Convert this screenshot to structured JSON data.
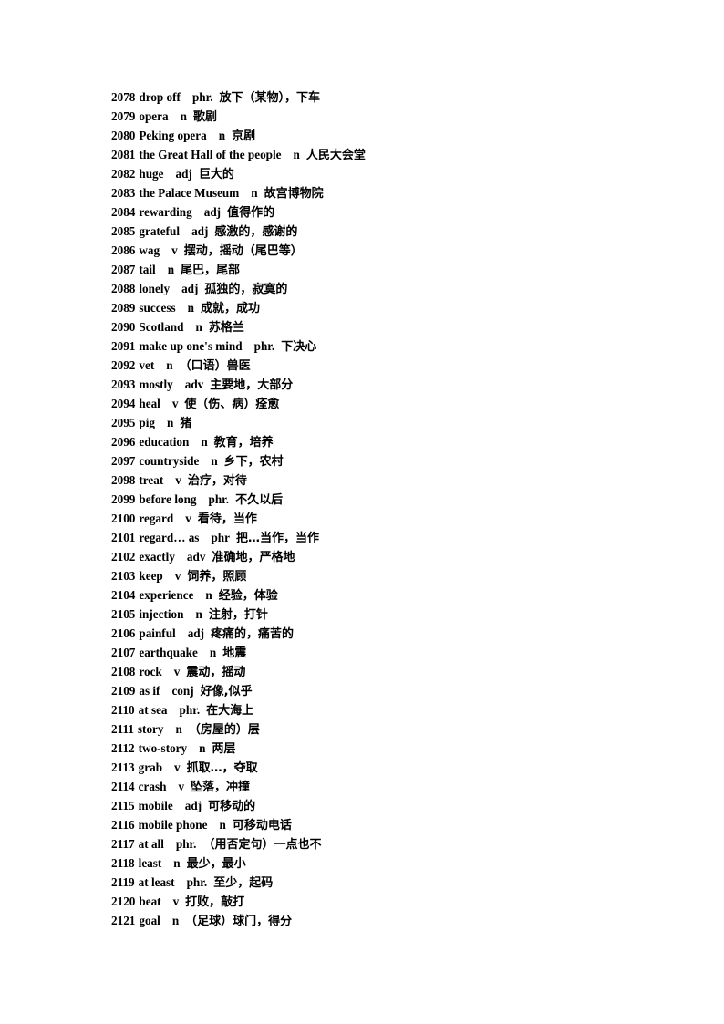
{
  "document": {
    "type": "vocabulary-word-list",
    "entry_range": "2078-2121",
    "entry_count": 44,
    "text_color": "#000000",
    "background_color": "#ffffff"
  },
  "entries": [
    {
      "index": "2078",
      "term": "drop off",
      "pos": "phr.",
      "definition": "放下（某物），下车"
    },
    {
      "index": "2079",
      "term": "opera",
      "pos": "n",
      "definition": "歌剧"
    },
    {
      "index": "2080",
      "term": "Peking opera",
      "pos": "n",
      "definition": "京剧"
    },
    {
      "index": "2081",
      "term": "the Great Hall of the people",
      "pos": "n",
      "definition": "人民大会堂"
    },
    {
      "index": "2082",
      "term": "huge",
      "pos": "adj",
      "definition": "巨大的"
    },
    {
      "index": "2083",
      "term": "the Palace Museum",
      "pos": "n",
      "definition": "故宫博物院"
    },
    {
      "index": "2084",
      "term": "rewarding",
      "pos": "adj",
      "definition": "值得作的"
    },
    {
      "index": "2085",
      "term": "grateful",
      "pos": "adj",
      "definition": "感激的，感谢的"
    },
    {
      "index": "2086",
      "term": "wag",
      "pos": "v",
      "definition": "摆动，摇动（尾巴等）"
    },
    {
      "index": "2087",
      "term": "tail",
      "pos": "n",
      "definition": "尾巴，尾部"
    },
    {
      "index": "2088",
      "term": "lonely",
      "pos": "adj",
      "definition": "孤独的，寂寞的"
    },
    {
      "index": "2089",
      "term": "success",
      "pos": "n",
      "definition": "成就，成功"
    },
    {
      "index": "2090",
      "term": "Scotland",
      "pos": "n",
      "definition": "苏格兰"
    },
    {
      "index": "2091",
      "term": "make up one's mind",
      "pos": "phr.",
      "definition": "下决心"
    },
    {
      "index": "2092",
      "term": "vet",
      "pos": "n",
      "definition": "（口语）兽医"
    },
    {
      "index": "2093",
      "term": "mostly",
      "pos": "adv",
      "definition": "主要地，大部分"
    },
    {
      "index": "2094",
      "term": "heal",
      "pos": "v",
      "definition": "使（伤、病）痊愈"
    },
    {
      "index": "2095",
      "term": "pig",
      "pos": "n",
      "definition": "猪"
    },
    {
      "index": "2096",
      "term": "education",
      "pos": "n",
      "definition": "教育，培养"
    },
    {
      "index": "2097",
      "term": "countryside",
      "pos": "n",
      "definition": "乡下，农村"
    },
    {
      "index": "2098",
      "term": "treat",
      "pos": "v",
      "definition": "治疗，对待"
    },
    {
      "index": "2099",
      "term": "before long",
      "pos": "phr.",
      "definition": "不久以后"
    },
    {
      "index": "2100",
      "term": "regard",
      "pos": "v",
      "definition": "看待，当作"
    },
    {
      "index": "2101",
      "term": "regard… as",
      "pos": "phr",
      "definition": "把…当作，当作"
    },
    {
      "index": "2102",
      "term": "exactly",
      "pos": "adv",
      "definition": "准确地，严格地"
    },
    {
      "index": "2103",
      "term": "keep",
      "pos": "v",
      "definition": "饲养，照顾"
    },
    {
      "index": "2104",
      "term": "experience",
      "pos": "n",
      "definition": "经验，体验"
    },
    {
      "index": "2105",
      "term": "injection",
      "pos": "n",
      "definition": "注射，打针"
    },
    {
      "index": "2106",
      "term": "painful",
      "pos": "adj",
      "definition": "疼痛的，痛苦的"
    },
    {
      "index": "2107",
      "term": "earthquake",
      "pos": "n",
      "definition": "地震"
    },
    {
      "index": "2108",
      "term": "rock",
      "pos": "v",
      "definition": "震动，摇动"
    },
    {
      "index": "2109",
      "term": "as if",
      "pos": "conj",
      "definition": "好像,似乎"
    },
    {
      "index": "2110",
      "term": "at sea",
      "pos": "phr.",
      "definition": "在大海上"
    },
    {
      "index": "2111",
      "term": "story",
      "pos": "n",
      "definition": "（房屋的）层"
    },
    {
      "index": "2112",
      "term": "two-story",
      "pos": "n",
      "definition": "两层"
    },
    {
      "index": "2113",
      "term": "grab",
      "pos": "v",
      "definition": "抓取…，夺取"
    },
    {
      "index": "2114",
      "term": "crash",
      "pos": "v",
      "definition": "坠落，冲撞"
    },
    {
      "index": "2115",
      "term": "mobile",
      "pos": "adj",
      "definition": "可移动的"
    },
    {
      "index": "2116",
      "term": "mobile phone",
      "pos": "n",
      "definition": "可移动电话"
    },
    {
      "index": "2117",
      "term": "at all",
      "pos": "phr.",
      "definition": "（用否定句）一点也不"
    },
    {
      "index": "2118",
      "term": "least",
      "pos": "n",
      "definition": "最少，最小"
    },
    {
      "index": "2119",
      "term": "at least",
      "pos": "phr.",
      "definition": "至少，起码"
    },
    {
      "index": "2120",
      "term": "beat",
      "pos": "v",
      "definition": "打败，敲打"
    },
    {
      "index": "2121",
      "term": "goal",
      "pos": "n",
      "definition": "（足球）球门，得分"
    }
  ]
}
